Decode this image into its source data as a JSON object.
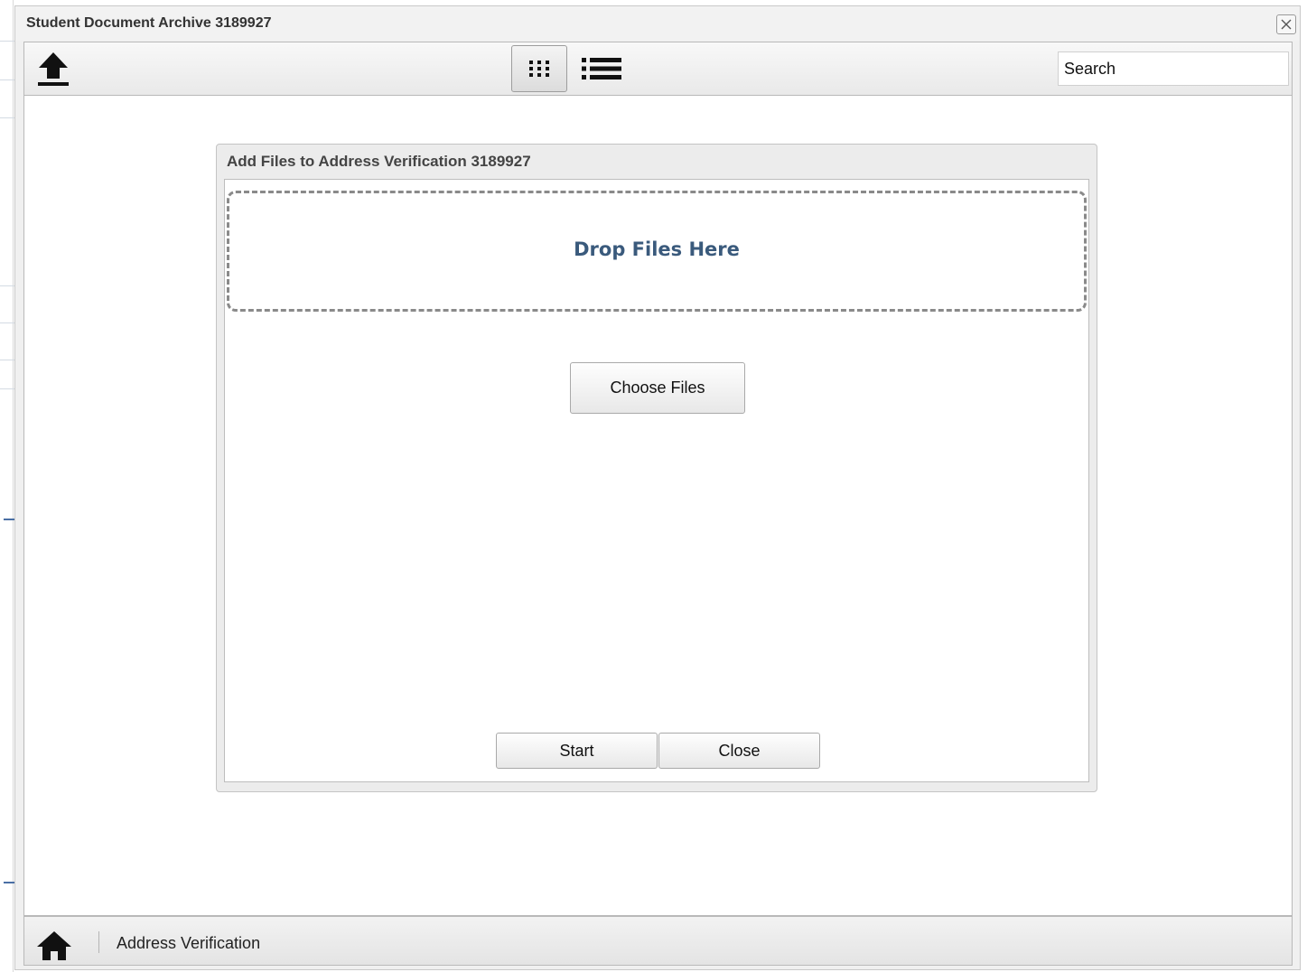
{
  "window": {
    "title": "Student Document Archive 3189927"
  },
  "toolbar": {
    "upload_icon": "upload-icon",
    "grid_view_icon": "grid-view-icon",
    "list_view_icon": "list-view-icon",
    "active_view": "grid",
    "search_placeholder": "Search"
  },
  "dialog": {
    "title": "Add Files to Address Verification 3189927",
    "dropzone_text": "Drop Files Here",
    "choose_label": "Choose Files",
    "start_label": "Start",
    "close_label": "Close"
  },
  "footer": {
    "home_icon": "home-icon",
    "breadcrumb": "Address Verification"
  },
  "colors": {
    "dropzone_text": "#3a5a7c",
    "dropzone_border": "#8a8a8a"
  }
}
